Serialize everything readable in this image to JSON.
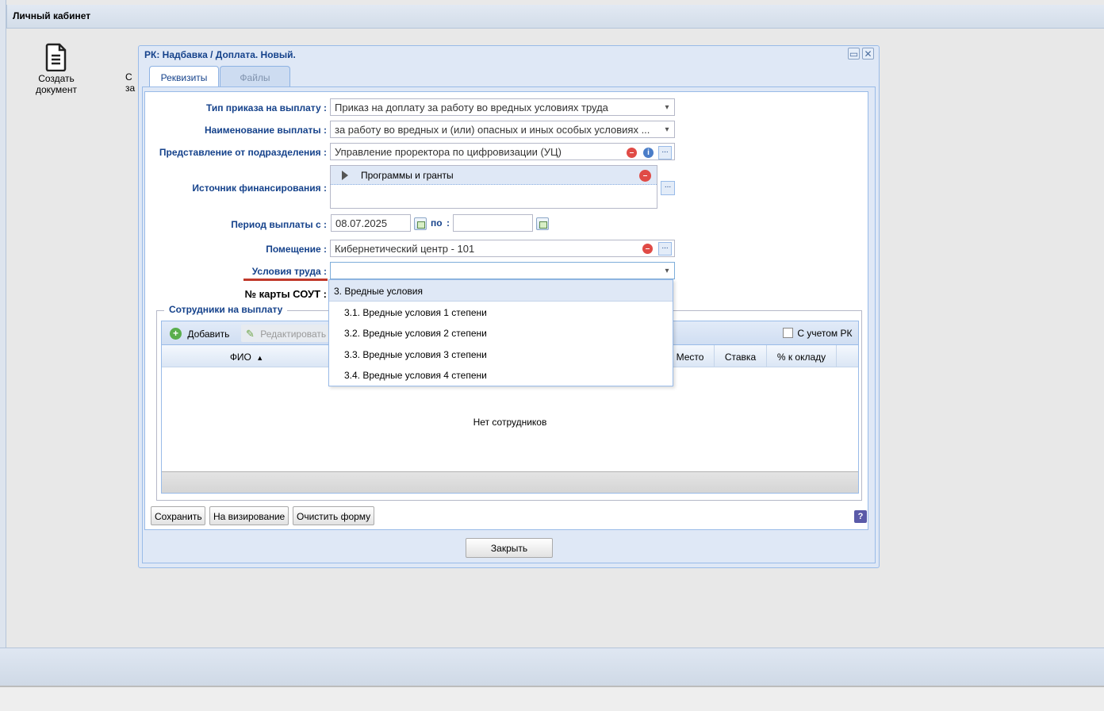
{
  "app": {
    "title": "Личный кабинет"
  },
  "desktop": {
    "icons": [
      {
        "label_line1": "Создать",
        "label_line2": "документ"
      },
      {
        "label_line1": "С",
        "label_line2": "за"
      }
    ]
  },
  "window": {
    "title": "РК: Надбавка / Доплата. Новый.",
    "tabs": [
      "Реквизиты",
      "Файлы"
    ]
  },
  "form": {
    "order_type": {
      "label": "Тип приказа на выплату :",
      "value": "Приказ на доплату за работу во вредных условиях труда"
    },
    "payment_name": {
      "label": "Наименование выплаты :",
      "value": "за работу во вредных и (или) опасных и иных особых условиях ..."
    },
    "department": {
      "label": "Представление от подразделения :",
      "value": "Управление проректора по цифровизации (УЦ)"
    },
    "funding": {
      "label": "Источник финансирования :",
      "items": [
        "Программы и гранты"
      ]
    },
    "period": {
      "label": "Период выплаты с :",
      "from": "08.07.2025",
      "to_label": "по",
      "to_colon": ":",
      "to": ""
    },
    "room": {
      "label": "Помещение :",
      "value": "Кибернетический центр - 101"
    },
    "work_conditions": {
      "label": "Условия труда :",
      "value": ""
    },
    "sout_card": {
      "label": "№ карты СОУТ :"
    }
  },
  "work_conditions_options": [
    "3. Вредные условия",
    "3.1. Вредные условия 1 степени",
    "3.2. Вредные условия 2 степени",
    "3.3. Вредные условия 3 степени",
    "3.4. Вредные условия 4 степени"
  ],
  "employees": {
    "legend": "Сотрудники на выплату",
    "toolbar": {
      "add": "Добавить",
      "edit": "Редактировать",
      "rk_checkbox": "С учетом РК"
    },
    "columns": [
      "ФИО",
      "Место",
      "Ставка",
      "% к окладу"
    ],
    "empty_text": "Нет сотрудников"
  },
  "buttons": {
    "save": "Сохранить",
    "approve": "На визирование",
    "clear": "Очистить форму",
    "close": "Закрыть",
    "help": "?"
  },
  "colors": {
    "accent": "#15428b",
    "panel": "#dfe8f6",
    "border": "#99bbe8",
    "required_underline": "#c0392b"
  }
}
